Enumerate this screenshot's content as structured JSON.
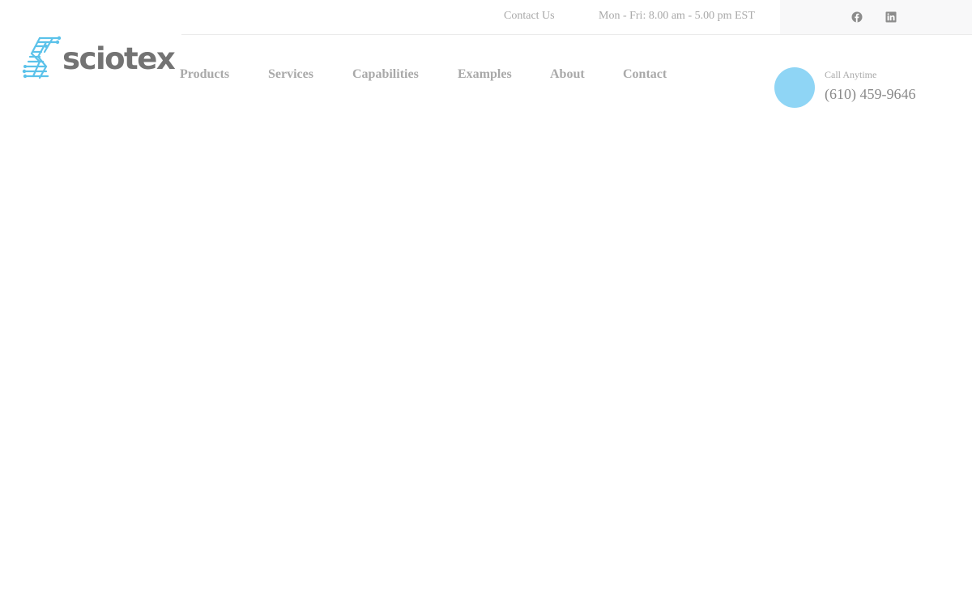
{
  "topbar": {
    "contact_link": "Contact Us",
    "hours": "Mon - Fri: 8.00 am - 5.00 pm EST",
    "social": [
      "facebook-icon",
      "linkedin-icon"
    ]
  },
  "logo": {
    "text": "sciotex",
    "icon": "dna-circuit-icon",
    "colors": {
      "icon": "#5bc2ea",
      "text": "#737373"
    }
  },
  "nav": {
    "items": [
      {
        "label": "Products"
      },
      {
        "label": "Services"
      },
      {
        "label": "Capabilities"
      },
      {
        "label": "Examples"
      },
      {
        "label": "About"
      },
      {
        "label": "Contact"
      }
    ]
  },
  "call": {
    "label": "Call Anytime",
    "number": "(610) 459-9646",
    "accent_color": "#8fd5f5"
  }
}
